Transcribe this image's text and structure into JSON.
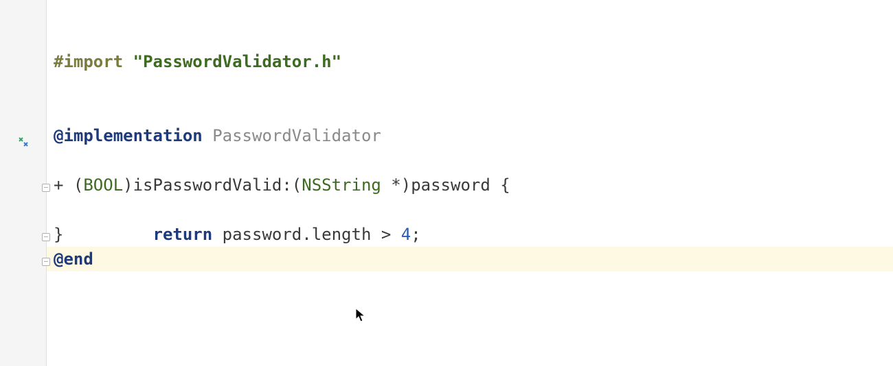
{
  "code": {
    "line1": {
      "import_kw": "#import",
      "string_q1": "\"",
      "string_body": "PasswordValidator.h",
      "string_q2": "\""
    },
    "line4": {
      "directive": "@implementation",
      "classname": "PasswordValidator"
    },
    "line6": {
      "prefix": "+ (",
      "type": "BOOL",
      "mid": ")",
      "method": "isPasswordValid:(",
      "paramtype": "NSString",
      "suffix": " *)password {"
    },
    "line7": {
      "indent": "    ",
      "return_kw": "return",
      "expr": " password.length > ",
      "num": "4",
      "semi": ";"
    },
    "line8": {
      "brace": "}"
    },
    "line9": {
      "directive": "@end"
    }
  },
  "gutter": {
    "override_icon": "override-icon"
  }
}
